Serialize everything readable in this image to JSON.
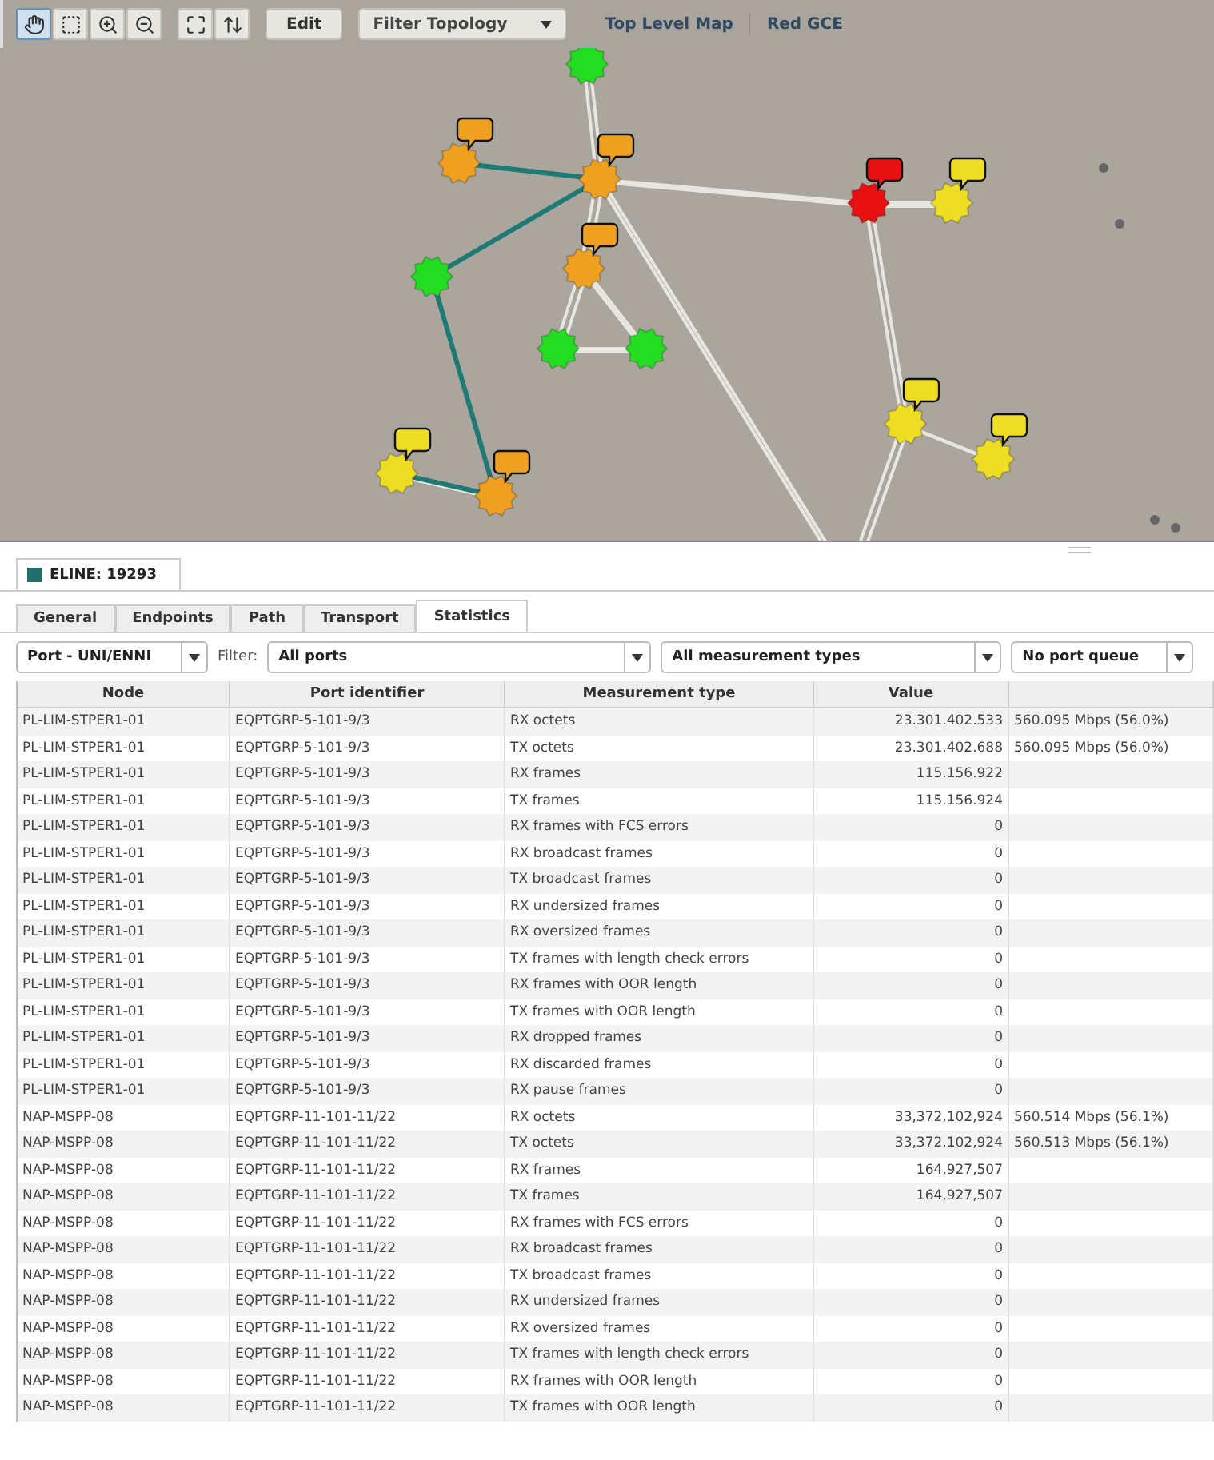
{
  "toolbar": {
    "tools": [
      {
        "kind": "hand",
        "selected": true
      },
      {
        "kind": "marquee",
        "selected": false
      },
      {
        "kind": "zoom-in",
        "selected": false
      },
      {
        "kind": "zoom-out",
        "selected": false
      },
      {
        "kind": "fit",
        "selected": false
      },
      {
        "kind": "pan",
        "selected": false
      }
    ],
    "edit_button": "Edit",
    "filter_dropdown": "Filter Topology",
    "breadcrumbs": [
      "Top Level Map",
      "Red GCE"
    ]
  },
  "detail": {
    "title": "ELINE: 19293",
    "tabs": [
      {
        "label": "General",
        "selected": false
      },
      {
        "label": "Endpoints",
        "selected": false
      },
      {
        "label": "Path",
        "selected": false
      },
      {
        "label": "Transport",
        "selected": false
      },
      {
        "label": "Statistics",
        "selected": true
      }
    ],
    "port_type": "Port - UNI/ENNI",
    "filter_label": "Filter:",
    "port_filter": "All ports",
    "measurement_filter": "All measurement types",
    "queue_filter": "No port queue",
    "table": {
      "columns": [
        "Node",
        "Port identifier",
        "Measurement type",
        "Value"
      ],
      "rows": [
        {
          "node": "PL-LIM-STPER1-01",
          "port": "EQPTGRP-5-101-9/3",
          "measurement": "RX octets",
          "value": "23.301.402.533",
          "rate": "560.095 Mbps (56.0%)"
        },
        {
          "node": "PL-LIM-STPER1-01",
          "port": "EQPTGRP-5-101-9/3",
          "measurement": "TX octets",
          "value": "23.301.402.688",
          "rate": "560.095 Mbps (56.0%)"
        },
        {
          "node": "PL-LIM-STPER1-01",
          "port": "EQPTGRP-5-101-9/3",
          "measurement": "RX frames",
          "value": "115.156.922"
        },
        {
          "node": "PL-LIM-STPER1-01",
          "port": "EQPTGRP-5-101-9/3",
          "measurement": "TX frames",
          "value": "115.156.924"
        },
        {
          "node": "PL-LIM-STPER1-01",
          "port": "EQPTGRP-5-101-9/3",
          "measurement": "RX frames with FCS errors",
          "value": "0"
        },
        {
          "node": "PL-LIM-STPER1-01",
          "port": "EQPTGRP-5-101-9/3",
          "measurement": "RX broadcast frames",
          "value": "0"
        },
        {
          "node": "PL-LIM-STPER1-01",
          "port": "EQPTGRP-5-101-9/3",
          "measurement": "TX broadcast frames",
          "value": "0"
        },
        {
          "node": "PL-LIM-STPER1-01",
          "port": "EQPTGRP-5-101-9/3",
          "measurement": "RX undersized frames",
          "value": "0"
        },
        {
          "node": "PL-LIM-STPER1-01",
          "port": "EQPTGRP-5-101-9/3",
          "measurement": "RX oversized frames",
          "value": "0"
        },
        {
          "node": "PL-LIM-STPER1-01",
          "port": "EQPTGRP-5-101-9/3",
          "measurement": "TX frames with length check errors",
          "value": "0"
        },
        {
          "node": "PL-LIM-STPER1-01",
          "port": "EQPTGRP-5-101-9/3",
          "measurement": "RX frames with OOR length",
          "value": "0"
        },
        {
          "node": "PL-LIM-STPER1-01",
          "port": "EQPTGRP-5-101-9/3",
          "measurement": "TX frames with OOR length",
          "value": "0"
        },
        {
          "node": "PL-LIM-STPER1-01",
          "port": "EQPTGRP-5-101-9/3",
          "measurement": "RX dropped frames",
          "value": "0"
        },
        {
          "node": "PL-LIM-STPER1-01",
          "port": "EQPTGRP-5-101-9/3",
          "measurement": "RX discarded frames",
          "value": "0"
        },
        {
          "node": "PL-LIM-STPER1-01",
          "port": "EQPTGRP-5-101-9/3",
          "measurement": "RX pause frames",
          "value": "0"
        },
        {
          "node": "NAP-MSPP-08",
          "port": "EQPTGRP-11-101-11/22",
          "measurement": "RX octets",
          "value": "33,372,102,924",
          "rate": "560.514 Mbps (56.1%)"
        },
        {
          "node": "NAP-MSPP-08",
          "port": "EQPTGRP-11-101-11/22",
          "measurement": "TX octets",
          "value": "33,372,102,924",
          "rate": "560.513 Mbps (56.1%)"
        },
        {
          "node": "NAP-MSPP-08",
          "port": "EQPTGRP-11-101-11/22",
          "measurement": "RX frames",
          "value": "164,927,507"
        },
        {
          "node": "NAP-MSPP-08",
          "port": "EQPTGRP-11-101-11/22",
          "measurement": "TX frames",
          "value": "164,927,507"
        },
        {
          "node": "NAP-MSPP-08",
          "port": "EQPTGRP-11-101-11/22",
          "measurement": "RX frames with FCS errors",
          "value": "0"
        },
        {
          "node": "NAP-MSPP-08",
          "port": "EQPTGRP-11-101-11/22",
          "measurement": "RX broadcast frames",
          "value": "0"
        },
        {
          "node": "NAP-MSPP-08",
          "port": "EQPTGRP-11-101-11/22",
          "measurement": "TX broadcast frames",
          "value": "0"
        },
        {
          "node": "NAP-MSPP-08",
          "port": "EQPTGRP-11-101-11/22",
          "measurement": "RX undersized frames",
          "value": "0"
        },
        {
          "node": "NAP-MSPP-08",
          "port": "EQPTGRP-11-101-11/22",
          "measurement": "RX oversized frames",
          "value": "0"
        },
        {
          "node": "NAP-MSPP-08",
          "port": "EQPTGRP-11-101-11/22",
          "measurement": "TX frames with length check errors",
          "value": "0"
        },
        {
          "node": "NAP-MSPP-08",
          "port": "EQPTGRP-11-101-11/22",
          "measurement": "RX frames with OOR length",
          "value": "0"
        },
        {
          "node": "NAP-MSPP-08",
          "port": "EQPTGRP-11-101-11/22",
          "measurement": "TX frames with OOR length",
          "value": "0"
        }
      ]
    }
  }
}
